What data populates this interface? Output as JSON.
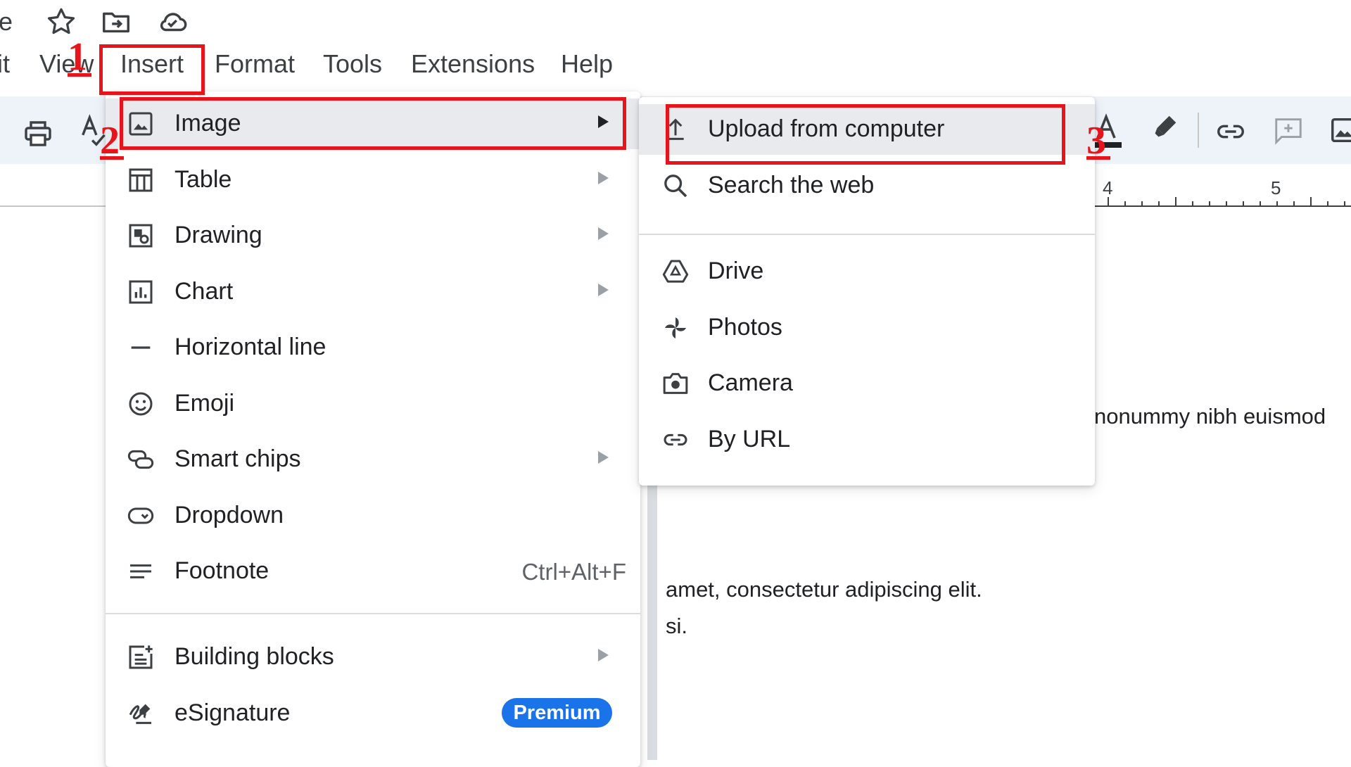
{
  "window": {
    "title_fragment": "e"
  },
  "menubar": {
    "edit_fragment": "it",
    "view": "View",
    "insert": "Insert",
    "format": "Format",
    "tools": "Tools",
    "extensions": "Extensions",
    "help": "Help"
  },
  "ruler": {
    "tick_4": "4",
    "tick_5": "5"
  },
  "document": {
    "line1_fragment": "nonummy nibh euismod",
    "line2_fragment": "amet, consectetur adipiscing elit.",
    "line3_fragment": "si."
  },
  "insert_menu": {
    "items": [
      {
        "label": "Image",
        "icon": "image-icon",
        "submenu": true
      },
      {
        "label": "Table",
        "icon": "table-icon",
        "submenu": true
      },
      {
        "label": "Drawing",
        "icon": "drawing-icon",
        "submenu": true
      },
      {
        "label": "Chart",
        "icon": "chart-icon",
        "submenu": true
      },
      {
        "label": "Horizontal line",
        "icon": "horizontal-line-icon",
        "submenu": false
      },
      {
        "label": "Emoji",
        "icon": "emoji-icon",
        "submenu": false
      },
      {
        "label": "Smart chips",
        "icon": "smart-chips-icon",
        "submenu": true
      },
      {
        "label": "Dropdown",
        "icon": "dropdown-icon",
        "submenu": false
      },
      {
        "label": "Footnote",
        "icon": "footnote-icon",
        "submenu": false,
        "shortcut": "Ctrl+Alt+F"
      },
      {
        "label": "Building blocks",
        "icon": "building-blocks-icon",
        "submenu": true
      },
      {
        "label": "eSignature",
        "icon": "esignature-icon",
        "submenu": false,
        "badge": "Premium"
      }
    ]
  },
  "image_submenu": {
    "items": [
      {
        "label": "Upload from computer",
        "icon": "upload-icon"
      },
      {
        "label": "Search the web",
        "icon": "search-icon"
      },
      {
        "label": "Drive",
        "icon": "drive-icon"
      },
      {
        "label": "Photos",
        "icon": "photos-icon"
      },
      {
        "label": "Camera",
        "icon": "camera-icon"
      },
      {
        "label": "By URL",
        "icon": "link-icon"
      }
    ]
  },
  "annotations": {
    "step1": "1",
    "step2": "2",
    "step3": "3",
    "color": "#e8141c"
  },
  "colors": {
    "toolbar_bg": "#eef2f9",
    "highlight_bg": "#e9eaed",
    "premium_badge": "#1a73e8"
  }
}
